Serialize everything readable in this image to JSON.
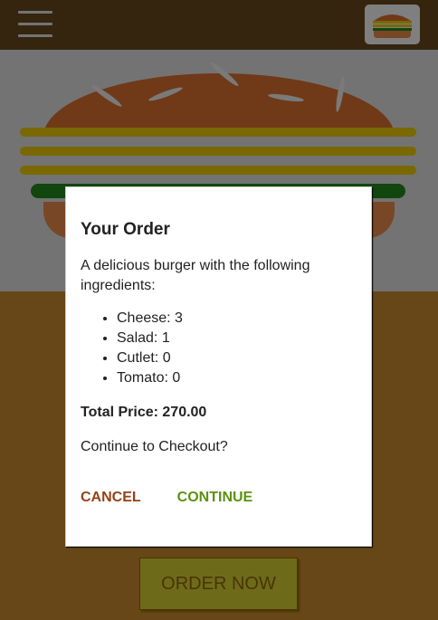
{
  "toolbar": {
    "menu_icon": "hamburger-menu-icon",
    "logo_icon": "burger-logo-icon"
  },
  "burger": {
    "layers": [
      "bread-top",
      "cheese",
      "cheese",
      "cheese",
      "salad",
      "bread-bottom"
    ]
  },
  "controls": {
    "order_label": "ORDER NOW"
  },
  "modal": {
    "title": "Your Order",
    "intro": "A delicious burger with the following ingredients:",
    "ingredients": [
      {
        "label": "Cheese: 3"
      },
      {
        "label": "Salad: 1"
      },
      {
        "label": "Cutlet: 0"
      },
      {
        "label": "Tomato: 0"
      }
    ],
    "price_label": "Total Price: 270.00",
    "checkout_question": "Continue to Checkout?",
    "cancel_label": "CANCEL",
    "continue_label": "CONTINUE"
  },
  "colors": {
    "toolbar": "#6a4a1f",
    "cancel": "#944317",
    "continue": "#5c9210"
  }
}
